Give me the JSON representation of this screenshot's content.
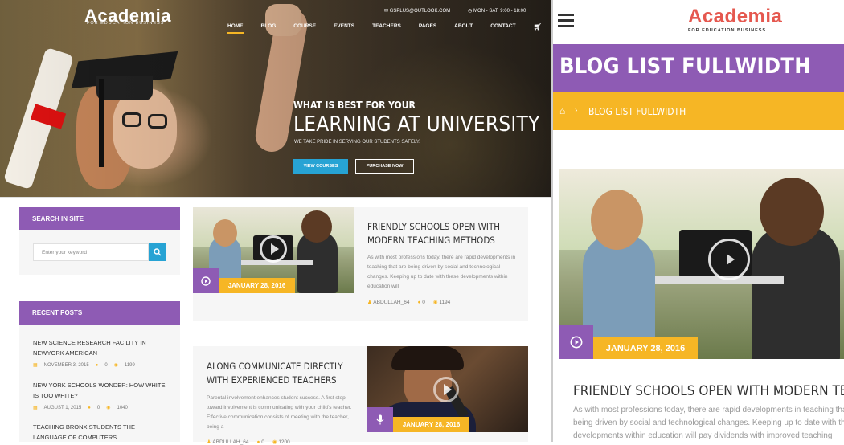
{
  "hero": {
    "logo": "Academia",
    "logo_sub": "FOR EDUCATION BUSINESS",
    "email": "GSPLUS@OUTLOOK.COM",
    "hours": "MON - SAT: 9:00 - 18:00",
    "nav": [
      "HOME",
      "BLOG",
      "COURSE",
      "EVENTS",
      "TEACHERS",
      "PAGES",
      "ABOUT",
      "CONTACT"
    ],
    "pre_title": "WHAT IS BEST FOR YOUR",
    "title": "LEARNING AT UNIVERSITY",
    "subtitle": "WE TAKE PRIDE IN SERVING OUR STUDENTS SAFELY.",
    "btn_primary": "VIEW COURSES",
    "btn_secondary": "PURCHASE NOW"
  },
  "sidebar": {
    "search_title": "SEARCH IN SITE",
    "search_placeholder": "Enter your keyword",
    "recent_title": "RECENT POSTS",
    "recent": [
      {
        "title": "NEW SCIENCE RESEARCH FACILITY IN NEWYORK AMERICAN",
        "date": "NOVEMBER 3, 2015",
        "comments": "0",
        "views": "1199"
      },
      {
        "title": "NEW YORK SCHOOLS WONDER: HOW WHITE IS TOO WHITE?",
        "date": "AUGUST 1, 2015",
        "comments": "0",
        "views": "1040"
      },
      {
        "title": "TEACHING BRONX STUDENTS THE LANGUAGE OF COMPUTERS"
      }
    ]
  },
  "posts": [
    {
      "title": "FRIENDLY SCHOOLS OPEN WITH MODERN TEACHING METHODS",
      "text": "As with most professions today, there are rapid developments in teaching that are being driven by social and technological changes. Keeping up to date with these developments within education will",
      "date": "JANUARY 28, 2016",
      "author": "ABDULLAH_64",
      "comments": "0",
      "views": "1194"
    },
    {
      "title": "ALONG COMMUNICATE DIRECTLY WITH EXPERIENCED TEACHERS",
      "text": "Parental involvement enhances student success. A first step toward involvement is communicating with your child's teacher. Effective communication consists of meeting with the teacher, being a",
      "date": "JANUARY 28, 2016",
      "author": "ABDULLAH_64",
      "comments": "0",
      "views": "1200"
    }
  ],
  "mobile": {
    "logo": "Academia",
    "logo_sub": "FOR EDUCATION BUSINESS",
    "page_title": "BLOG LIST FULLWIDTH",
    "breadcrumb": "BLOG LIST FULLWIDTH",
    "date": "JANUARY 28, 2016",
    "post_title": "FRIENDLY SCHOOLS OPEN WITH MODERN TEACHING METHO",
    "post_text_1": "As with most professions today, there are rapid developments in teaching that are",
    "post_text_2": "being driven by social and technological changes. Keeping up to date with these",
    "post_text_3": "developments within education will pay dividends with improved teaching"
  },
  "colors": {
    "purple": "#8e5bb4",
    "orange": "#f6b625",
    "blue": "#27a3d4"
  },
  "icons": [
    "cart-icon",
    "search-icon",
    "play-icon",
    "mic-icon",
    "hamburger-icon",
    "home-icon",
    "user-icon",
    "comment-icon",
    "eye-icon",
    "calendar-icon",
    "email-icon",
    "clock-icon"
  ]
}
